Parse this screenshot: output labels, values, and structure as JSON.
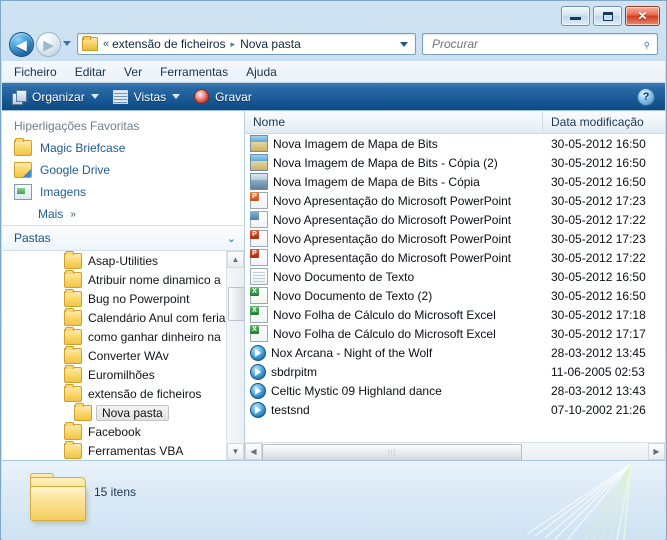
{
  "window": {
    "controls": {
      "minimize": "–",
      "maximize": "□",
      "close": "✕"
    }
  },
  "nav": {
    "back_label": "◀",
    "forward_label": "▶",
    "history_dropdown": "▾",
    "refresh_label": "↻"
  },
  "address": {
    "folder_icon": "folder-icon",
    "overflow": "«",
    "crumbs": [
      "extensão de ficheiros",
      "Nova pasta"
    ],
    "separator": "▸",
    "dropdown": "▾"
  },
  "search": {
    "placeholder": "Procurar",
    "value": "",
    "icon": "search-icon"
  },
  "menu": {
    "items": [
      {
        "label": "Ficheiro"
      },
      {
        "label": "Editar"
      },
      {
        "label": "Ver"
      },
      {
        "label": "Ferramentas"
      },
      {
        "label": "Ajuda"
      }
    ]
  },
  "toolbar": {
    "organize_label": "Organizar",
    "views_label": "Vistas",
    "burn_label": "Gravar",
    "help_label": "?"
  },
  "sidebar": {
    "favorites_header": "Hiperligações Favoritas",
    "favorites": [
      {
        "label": "Magic Briefcase",
        "icon": "folder-icon"
      },
      {
        "label": "Google Drive",
        "icon": "google-drive-icon"
      },
      {
        "label": "Imagens",
        "icon": "pictures-icon"
      }
    ],
    "more_label": "Mais",
    "more_chevron": "»",
    "folders_header": "Pastas",
    "folders_chevron": "⌄",
    "tree": [
      {
        "label": "Asap-Utilities",
        "selected": false
      },
      {
        "label": "Atribuir nome dinamico a",
        "selected": false
      },
      {
        "label": "Bug no Powerpoint",
        "selected": false
      },
      {
        "label": "Calendário Anul com feria",
        "selected": false
      },
      {
        "label": "como ganhar dinheiro na",
        "selected": false
      },
      {
        "label": "Converter WAv",
        "selected": false
      },
      {
        "label": "Euromilhões",
        "selected": false
      },
      {
        "label": "extensão de ficheiros",
        "selected": false
      },
      {
        "label": "Nova pasta",
        "selected": true
      },
      {
        "label": "Facebook",
        "selected": false
      },
      {
        "label": "Ferramentas VBA",
        "selected": false
      }
    ],
    "scroll": {
      "up": "▲",
      "down": "▼"
    }
  },
  "filelist": {
    "columns": {
      "name": "Nome",
      "date": "Data modificação"
    },
    "rows": [
      {
        "name": "Nova Imagem de Mapa de Bits",
        "date": "30-05-2012 16:50",
        "icon": "bitmap-image-icon"
      },
      {
        "name": "Nova Imagem de Mapa de Bits - Cópia (2)",
        "date": "30-05-2012 16:50",
        "icon": "bitmap-image-icon"
      },
      {
        "name": "Nova Imagem de Mapa de Bits - Cópia",
        "date": "30-05-2012 16:50",
        "icon": "bitmap-image-alt-icon"
      },
      {
        "name": "Novo Apresentação do Microsoft PowerPoint",
        "date": "30-05-2012 17:23",
        "icon": "powerpoint-icon"
      },
      {
        "name": "Novo Apresentação do Microsoft PowerPoint",
        "date": "30-05-2012 17:22",
        "icon": "powerpoint-template-icon"
      },
      {
        "name": "Novo Apresentação do Microsoft PowerPoint",
        "date": "30-05-2012 17:23",
        "icon": "powerpoint-icon"
      },
      {
        "name": "Novo Apresentação do Microsoft PowerPoint",
        "date": "30-05-2012 17:22",
        "icon": "powerpoint-icon"
      },
      {
        "name": "Novo Documento de Texto",
        "date": "30-05-2012 16:50",
        "icon": "text-document-icon"
      },
      {
        "name": "Novo Documento de Texto (2)",
        "date": "30-05-2012 16:50",
        "icon": "excel-icon"
      },
      {
        "name": "Novo Folha de Cálculo do Microsoft Excel",
        "date": "30-05-2012 17:18",
        "icon": "excel-icon"
      },
      {
        "name": "Novo Folha de Cálculo do Microsoft Excel",
        "date": "30-05-2012 17:17",
        "icon": "excel-icon"
      },
      {
        "name": "Nox Arcana - Night of the Wolf",
        "date": "28-03-2012 13:45",
        "icon": "media-player-icon"
      },
      {
        "name": "sbdrpitm",
        "date": "11-06-2005 02:53",
        "icon": "media-player-icon"
      },
      {
        "name": "Celtic Mystic 09 Highland dance",
        "date": "28-03-2012 13:43",
        "icon": "media-player-icon"
      },
      {
        "name": "testsnd",
        "date": "07-10-2002 21:26",
        "icon": "media-player-icon"
      }
    ],
    "hscroll": {
      "left": "◀",
      "right": "▶",
      "grip": "⦙⦙⦙"
    }
  },
  "status": {
    "count_label": "15 itens",
    "folder_icon": "large-folder-icon"
  },
  "colors": {
    "toolbar_start": "#3e7db5",
    "toolbar_end": "#0d4a84",
    "link_blue": "#1f5c90",
    "close_red": "#cf3b20",
    "folder_yellow": "#f6ce62"
  }
}
